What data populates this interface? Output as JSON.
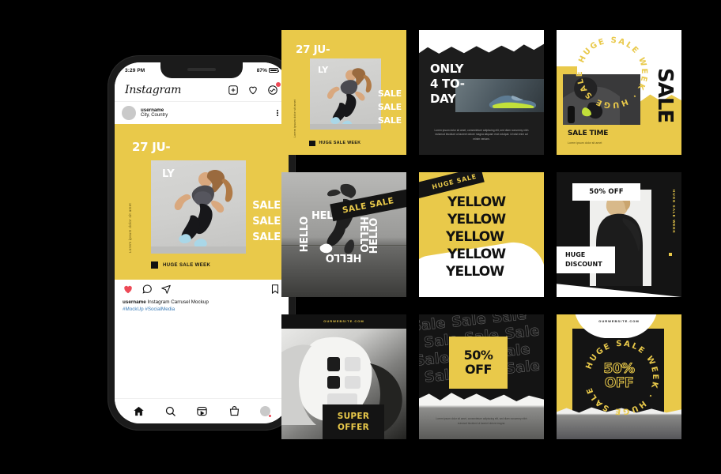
{
  "phone": {
    "status": {
      "time": "3:29 PM",
      "battery": "87%"
    },
    "header": {
      "logo": "Instagram"
    },
    "post_header": {
      "username": "username",
      "location": "City, Country"
    },
    "slide": {
      "date": "27 JU-",
      "ly": "LY",
      "sale1": "SALE",
      "sale2": "SALE",
      "sale3": "SALE",
      "vertical": "Lorem ipsum dolor sit amet",
      "tag": "HUGE SALE WEEK"
    },
    "caption": {
      "username": "username",
      "text": " Instagram Carrusel Mockup",
      "hashtags": "#MockUp #SocialMedia"
    }
  },
  "tiles": {
    "t1": {
      "date": "27 JU-",
      "ly": "LY",
      "sale1": "SALE",
      "sale2": "SALE",
      "sale3": "SALE",
      "vertical": "Lorem ipsum dolor sit amet",
      "tag": "HUGE SALE WEEK"
    },
    "t2": {
      "headline": "ONLY\n4 TO-\nDAY",
      "lorem": "Lorem ipsum dolor sit amet, consectetuer adipiscing elit, sed diam nonummy nibh euismod tincidunt ut laoreet dolore magna aliquam erat volutpat. Ut wisi enim ad minim veniam."
    },
    "t3": {
      "circle_text": "HUGE SALE WEEK · HUGE SALE WEEK ·",
      "sale_vertical": "SALE",
      "title": "SALE TIME",
      "sub": "Lorem ipsum dolor sit amet"
    },
    "t4": {
      "hello1": "HELLO",
      "hello2": "HELLO",
      "hello3": "HELLO",
      "hello4": "HELLO",
      "hello5": "HELLO",
      "band": "SALE SALE"
    },
    "t5": {
      "band": "HUGE SALE",
      "row1": "YELLOW",
      "row2": "YELLOW",
      "row3": "YELLOW",
      "row4": "YELLOW",
      "row5": "YELLOW"
    },
    "t6": {
      "percent": "50% OFF",
      "huge": "HUGE",
      "discount": "DISCOUNT",
      "vertical": "HUGE SALE WEEK"
    },
    "t7": {
      "url": "OURWEBSITE.COM",
      "super": "SUPER",
      "offer": "OFFER"
    },
    "t8": {
      "pattern_word": "Sale",
      "percent": "50%",
      "off": "OFF",
      "lorem": "Lorem ipsum dolor sit amet, consectetuer adipiscing elit, sed diam nonummy nibh euismod tincidunt ut laoreet dolore magna."
    },
    "t9": {
      "url": "OURWEBSITE.COM",
      "circle_text": "HUGE SALE WEEK · HUGE SALE WEEK ·",
      "percent": "50%",
      "off": "OFF"
    }
  },
  "colors": {
    "yellow": "#E9C94A",
    "black": "#141414",
    "white": "#ffffff",
    "red": "#ed4956",
    "link": "#3b7cb8"
  }
}
